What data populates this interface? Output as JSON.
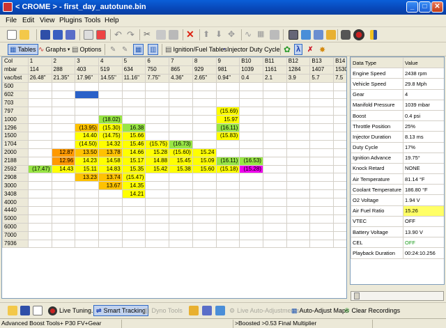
{
  "window": {
    "title": "< CROME > - first_day_autotune.bin"
  },
  "menu": [
    "File",
    "Edit",
    "View",
    "Plugins",
    "Tools",
    "Help"
  ],
  "toolbar2": {
    "tables": "Tables",
    "graphs": "Graphs",
    "options": "Options",
    "ign_fuel": "Ignition/Fuel Tables",
    "inj_duty": "Injector Duty Cycle"
  },
  "grid": {
    "header": [
      "Col",
      "1",
      "2",
      "3",
      "4",
      "5",
      "6",
      "7",
      "8",
      "9",
      "B10",
      "B11",
      "B12",
      "B13",
      "B14"
    ],
    "mbar": [
      "mbar",
      "114",
      "288",
      "403",
      "519",
      "634",
      "750",
      "865",
      "929",
      "981",
      "1039",
      "1161",
      "1284",
      "1407",
      "1530"
    ],
    "vacboost": [
      "vac/bst",
      "26.48\"",
      "21.35\"",
      "17.96\"",
      "14.55\"",
      "11.16\"",
      "7.75\"",
      "4.36\"",
      "2.65\"",
      "0.94\"",
      "0.4",
      "2.1",
      "3.9",
      "5.7",
      "7.5"
    ],
    "rows": [
      {
        "rpm": "500",
        "cells": []
      },
      {
        "rpm": "602",
        "cells": [
          {
            "c": 3,
            "v": "",
            "k": "b"
          }
        ]
      },
      {
        "rpm": "703",
        "cells": []
      },
      {
        "rpm": "797",
        "cells": [
          {
            "c": 9,
            "v": "(15.69)",
            "k": "y"
          }
        ]
      },
      {
        "rpm": "1000",
        "cells": [
          {
            "c": 4,
            "v": "(18.02)",
            "k": "g"
          },
          {
            "c": 9,
            "v": "15.97",
            "k": "y"
          }
        ]
      },
      {
        "rpm": "1296",
        "cells": [
          {
            "c": 3,
            "v": "(13.95)",
            "k": "o"
          },
          {
            "c": 4,
            "v": "(15.30)",
            "k": "y"
          },
          {
            "c": 5,
            "v": "16.38",
            "k": "g"
          },
          {
            "c": 9,
            "v": "(16.11)",
            "k": "g"
          }
        ]
      },
      {
        "rpm": "1500",
        "cells": [
          {
            "c": 3,
            "v": "14.40",
            "k": "y"
          },
          {
            "c": 4,
            "v": "(14.75)",
            "k": "y"
          },
          {
            "c": 5,
            "v": "15.66",
            "k": "y"
          },
          {
            "c": 9,
            "v": "(15.83)",
            "k": "y"
          }
        ]
      },
      {
        "rpm": "1704",
        "cells": [
          {
            "c": 3,
            "v": "(14.50)",
            "k": "y"
          },
          {
            "c": 4,
            "v": "14.32",
            "k": "y"
          },
          {
            "c": 5,
            "v": "15.46",
            "k": "y"
          },
          {
            "c": 6,
            "v": "(15.75)",
            "k": "y"
          },
          {
            "c": 7,
            "v": "(16.73)",
            "k": "g"
          }
        ]
      },
      {
        "rpm": "2000",
        "cells": [
          {
            "c": 2,
            "v": "12.87",
            "k": "do"
          },
          {
            "c": 3,
            "v": "13.50",
            "k": "o"
          },
          {
            "c": 4,
            "v": "13.78",
            "k": "o"
          },
          {
            "c": 5,
            "v": "14.66",
            "k": "y"
          },
          {
            "c": 6,
            "v": "15.28",
            "k": "y"
          },
          {
            "c": 7,
            "v": "(15.60)",
            "k": "y"
          },
          {
            "c": 8,
            "v": "15.24",
            "k": "y"
          }
        ]
      },
      {
        "rpm": "2188",
        "cells": [
          {
            "c": 2,
            "v": "12.96",
            "k": "do"
          },
          {
            "c": 3,
            "v": "14.23",
            "k": "y"
          },
          {
            "c": 4,
            "v": "14.58",
            "k": "y"
          },
          {
            "c": 5,
            "v": "15.17",
            "k": "y"
          },
          {
            "c": 6,
            "v": "14.88",
            "k": "y"
          },
          {
            "c": 7,
            "v": "15.45",
            "k": "y"
          },
          {
            "c": 8,
            "v": "15.09",
            "k": "y"
          },
          {
            "c": 9,
            "v": "(16.11)",
            "k": "g"
          },
          {
            "c": 10,
            "v": "(16.53)",
            "k": "g"
          }
        ]
      },
      {
        "rpm": "2592",
        "cells": [
          {
            "c": 1,
            "v": "(17.47)",
            "k": "g"
          },
          {
            "c": 2,
            "v": "14.43",
            "k": "y"
          },
          {
            "c": 3,
            "v": "15.11",
            "k": "y"
          },
          {
            "c": 4,
            "v": "14.83",
            "k": "y"
          },
          {
            "c": 5,
            "v": "15.35",
            "k": "y"
          },
          {
            "c": 6,
            "v": "15.42",
            "k": "y"
          },
          {
            "c": 7,
            "v": "15.38",
            "k": "y"
          },
          {
            "c": 8,
            "v": "15.60",
            "k": "y"
          },
          {
            "c": 9,
            "v": "(15.18)",
            "k": "y"
          },
          {
            "c": 10,
            "v": "(15.28)",
            "k": "m"
          }
        ]
      },
      {
        "rpm": "2908",
        "cells": [
          {
            "c": 3,
            "v": "13.23",
            "k": "o"
          },
          {
            "c": 4,
            "v": "13.74",
            "k": "o"
          },
          {
            "c": 5,
            "v": "(15.47)",
            "k": "y"
          }
        ]
      },
      {
        "rpm": "3000",
        "cells": [
          {
            "c": 4,
            "v": "13.67",
            "k": "o"
          },
          {
            "c": 5,
            "v": "14.35",
            "k": "y"
          }
        ]
      },
      {
        "rpm": "3408",
        "cells": [
          {
            "c": 5,
            "v": "14.21",
            "k": "y"
          }
        ]
      },
      {
        "rpm": "4000",
        "cells": []
      },
      {
        "rpm": "4440",
        "cells": []
      },
      {
        "rpm": "5000",
        "cells": []
      },
      {
        "rpm": "6000",
        "cells": []
      },
      {
        "rpm": "7000",
        "cells": []
      },
      {
        "rpm": "7936",
        "cells": []
      }
    ]
  },
  "properties": {
    "header": [
      "Data Type",
      "Value"
    ],
    "rows": [
      [
        "Engine Speed",
        "2438 rpm"
      ],
      [
        "Vehicle Speed",
        "29.8 Mph"
      ],
      [
        "Gear",
        "4"
      ],
      [
        "Manifold Pressure",
        "1039 mbar"
      ],
      [
        "Boost",
        "0.4 psi"
      ],
      [
        "Throttle Position",
        "25%"
      ],
      [
        "Injector Duration",
        "8.13 ms"
      ],
      [
        "Duty Cycle",
        "17%"
      ],
      [
        "Ignition Advance",
        "19.75°"
      ],
      [
        "Knock Retard",
        "NONE"
      ],
      [
        "Air Temperature",
        "81.14 °F"
      ],
      [
        "Coolant Temperature",
        "186.80 °F"
      ],
      [
        "O2 Voltage",
        "1.94 V"
      ],
      [
        "Air Fuel Ratio",
        "15.26"
      ],
      [
        "VTEC",
        "OFF"
      ],
      [
        "Battery Voltage",
        "13.90 V"
      ],
      [
        "CEL",
        "OFF"
      ],
      [
        "Playback Duration",
        "00:24:10.256"
      ]
    ]
  },
  "bottombar": {
    "live_tuning": "Live Tuning...",
    "smart_tracking": "Smart Tracking",
    "dyno_tools": "Dyno Tools",
    "live_auto": "Live Auto-Adjustments",
    "auto_adjust": "Auto-Adjust Maps",
    "clear_rec": "Clear Recordings"
  },
  "status": {
    "left": "Advanced Boost Tools+ P30 FV+Gear",
    "mid": "",
    "right": ">Boosted >0.53 Final Multiplier"
  }
}
